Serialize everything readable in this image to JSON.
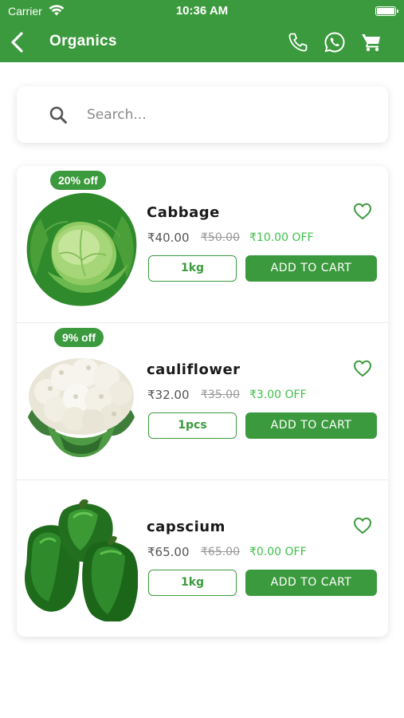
{
  "status_bar": {
    "carrier": "Carrier",
    "time": "10:36 AM"
  },
  "nav": {
    "title": "Organics"
  },
  "search": {
    "placeholder": "Search..."
  },
  "colors": {
    "primary": "#3c9a3e",
    "off_text": "#3fc04a"
  },
  "icons": {
    "back": "chevron-left-icon",
    "phone": "phone-icon",
    "whatsapp": "whatsapp-icon",
    "cart": "cart-icon",
    "search": "search-icon",
    "favorite": "heart-icon"
  },
  "products": [
    {
      "name": "Cabbage",
      "discount": "20% off",
      "price": "₹40.00",
      "old_price": "₹50.00",
      "off": "₹10.00 OFF",
      "quantity": "1kg",
      "add_label": "ADD TO CART"
    },
    {
      "name": "cauliflower",
      "discount": "9% off",
      "price": "₹32.00",
      "old_price": "₹35.00",
      "off": "₹3.00 OFF",
      "quantity": "1pcs",
      "add_label": "ADD TO CART"
    },
    {
      "name": "capscium",
      "price": "₹65.00",
      "old_price": "₹65.00",
      "off": "₹0.00 OFF",
      "quantity": "1kg",
      "add_label": "ADD TO CART"
    }
  ]
}
